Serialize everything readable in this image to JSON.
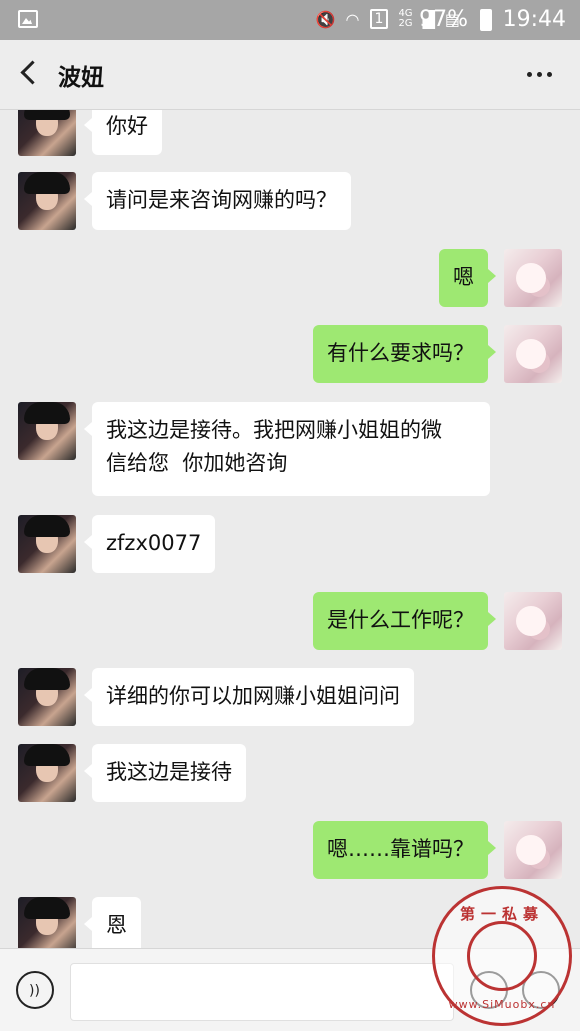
{
  "status_bar": {
    "network_top": "4G",
    "network_bottom": "2G",
    "sim": "1",
    "battery": "97%",
    "time": "19:44"
  },
  "header": {
    "title": "波妞"
  },
  "messages": [
    {
      "side": "left",
      "text": "你好"
    },
    {
      "side": "left",
      "text": "请问是来咨询网赚的吗？"
    },
    {
      "side": "right",
      "text": "嗯"
    },
    {
      "side": "right",
      "text": "有什么要求吗？"
    },
    {
      "side": "left",
      "text": "我这边是接待。我把网赚小姐姐的微\n信给您  你加她咨询"
    },
    {
      "side": "left",
      "text": "zfzx0077"
    },
    {
      "side": "right",
      "text": "是什么工作呢？"
    },
    {
      "side": "left",
      "text": "详细的你可以加网赚小姐姐问问"
    },
    {
      "side": "left",
      "text": "我这边是接待"
    },
    {
      "side": "right",
      "text": "嗯……靠谱吗？"
    },
    {
      "side": "left",
      "text": "恩"
    }
  ],
  "watermark": {
    "top_text": "第一私募",
    "bottom_text": "www.SiMuobx.cn"
  },
  "colors": {
    "sent_bubble": "#9ee872",
    "received_bubble": "#ffffff",
    "chat_bg": "#ebebeb",
    "status_bar": "#a6a6a6"
  }
}
